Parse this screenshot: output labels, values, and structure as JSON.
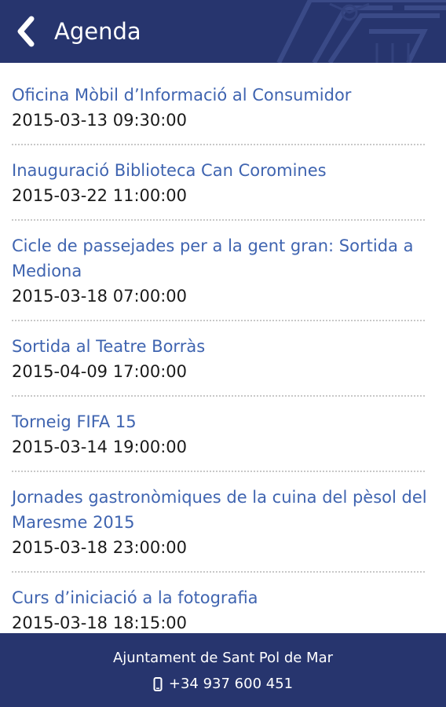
{
  "header": {
    "title": "Agenda",
    "back_icon": "chevron-left-icon",
    "background": "#27356e"
  },
  "events": [
    {
      "title": "Oficina Mòbil d’Informació al Consumidor",
      "date": "2015-03-13 09:30:00"
    },
    {
      "title": "Inauguració Biblioteca Can Coromines",
      "date": "2015-03-22 11:00:00"
    },
    {
      "title": "Cicle de passejades per a la gent gran: Sortida a Mediona",
      "date": "2015-03-18 07:00:00"
    },
    {
      "title": "Sortida al Teatre Borràs",
      "date": "2015-04-09 17:00:00"
    },
    {
      "title": "Torneig FIFA 15",
      "date": "2015-03-14 19:00:00"
    },
    {
      "title": "Jornades gastronòmiques de la cuina del pèsol del Maresme 2015",
      "date": "2015-03-18 23:00:00"
    },
    {
      "title": "Curs d’iniciació a la fotografia",
      "date": "2015-03-18 18:15:00"
    }
  ],
  "footer": {
    "organization": "Ajuntament de Sant Pol de Mar",
    "phone": "+34 937 600 451",
    "phone_icon": "mobile-phone-icon"
  },
  "colors": {
    "link": "#3f64b0",
    "date": "#1a1a1a",
    "bar": "#27356e"
  }
}
